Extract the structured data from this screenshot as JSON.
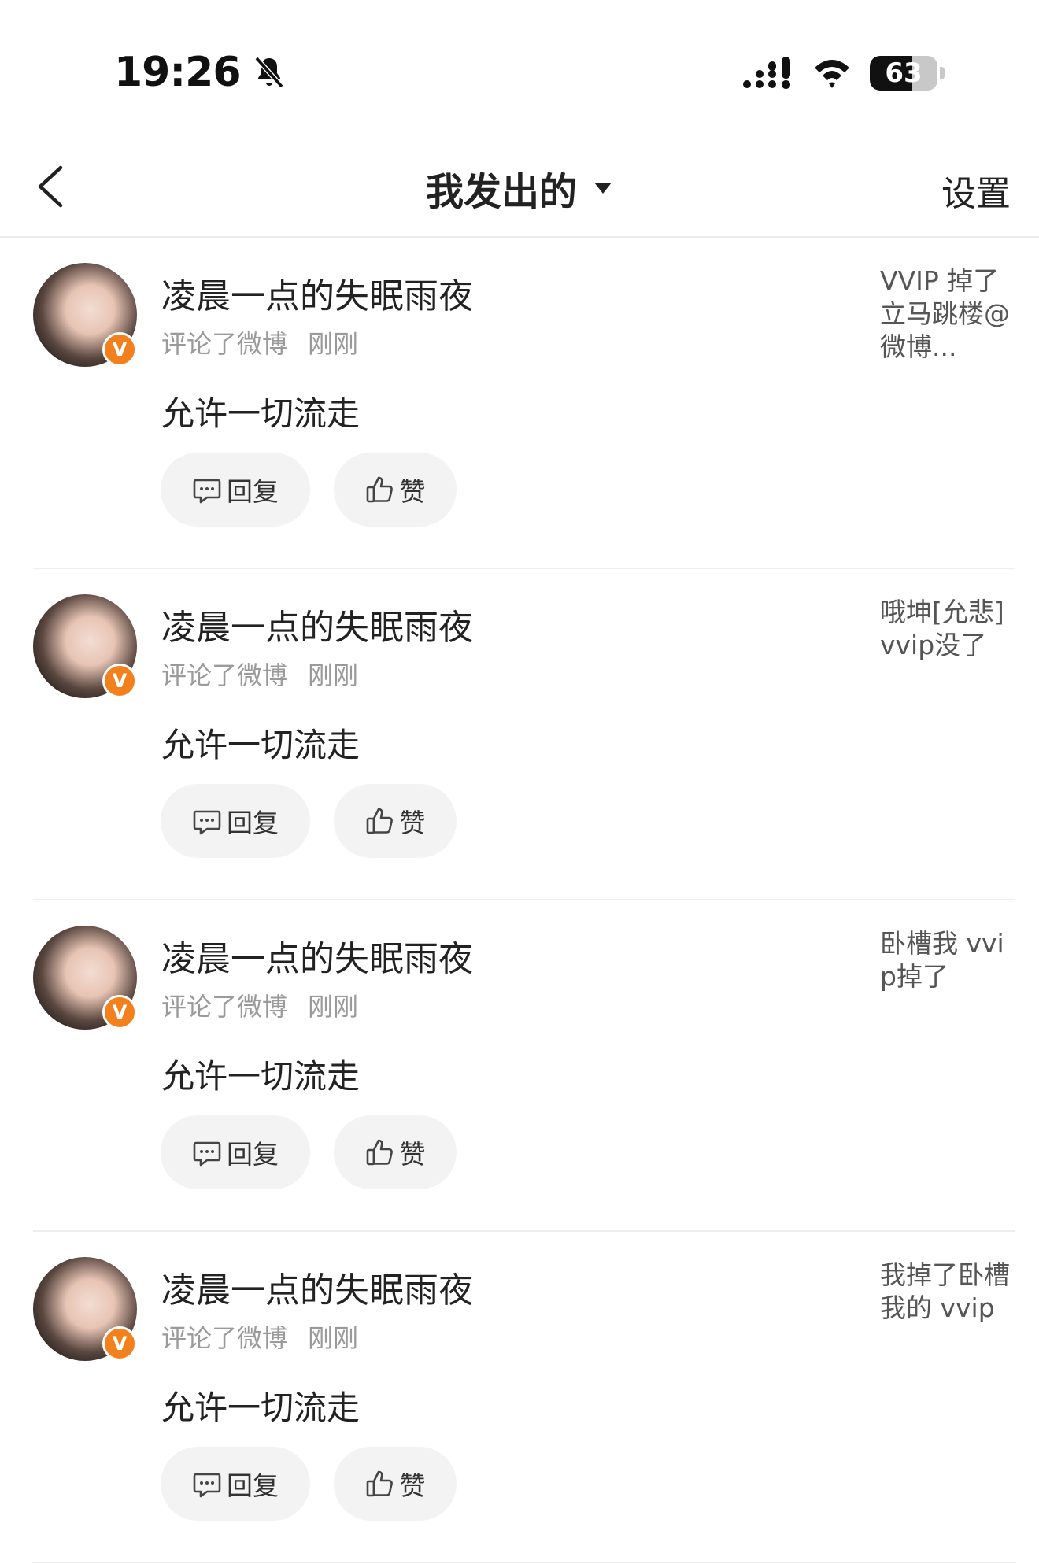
{
  "status_bar": {
    "time": "19:26",
    "battery_level": "63",
    "battery_fraction": 0.63,
    "icons": [
      "bell-slash-icon",
      "signal-icon",
      "wifi-icon",
      "battery-icon"
    ]
  },
  "nav": {
    "back_icon": "chevron-left-icon",
    "title": "我发出的",
    "title_icon": "caret-down-icon",
    "settings_label": "设置"
  },
  "colors": {
    "verified_badge": "#f2811d",
    "pill_background": "#f3f3f3",
    "meta_text": "#9a9a9a",
    "divider": "#eeeeee"
  },
  "items": [
    {
      "username": "凌晨一点的失眠雨夜",
      "action": "评论了微博",
      "time": "刚刚",
      "comment": "允许一切流走",
      "badge": "V",
      "reply_label": "回复",
      "like_label": "赞",
      "quote": "VVIP 掉了立马跳楼@微博..."
    },
    {
      "username": "凌晨一点的失眠雨夜",
      "action": "评论了微博",
      "time": "刚刚",
      "comment": "允许一切流走",
      "badge": "V",
      "reply_label": "回复",
      "like_label": "赞",
      "quote": "哦坤[允悲]vvip没了"
    },
    {
      "username": "凌晨一点的失眠雨夜",
      "action": "评论了微博",
      "time": "刚刚",
      "comment": "允许一切流走",
      "badge": "V",
      "reply_label": "回复",
      "like_label": "赞",
      "quote": "卧槽我 vvip掉了"
    },
    {
      "username": "凌晨一点的失眠雨夜",
      "action": "评论了微博",
      "time": "刚刚",
      "comment": "允许一切流走",
      "badge": "V",
      "reply_label": "回复",
      "like_label": "赞",
      "quote": "我掉了卧槽我的 vvip"
    }
  ]
}
